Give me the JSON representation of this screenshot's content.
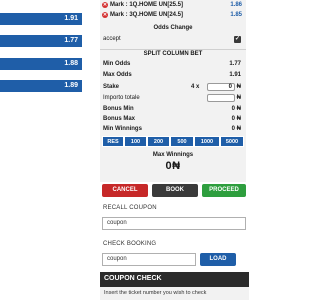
{
  "left_odds": [
    "1.91",
    "1.77",
    "1.88",
    "1.89"
  ],
  "selections": [
    {
      "label": "Mark : 1Q.HOME UN[25.5]",
      "odd": "1.86"
    },
    {
      "label": "Mark : 3Q.HOME UN[24.5]",
      "odd": "1.85"
    }
  ],
  "odds_change": {
    "title": "Odds Change",
    "accept_label": "accept"
  },
  "split": {
    "title": "SPLIT COLUMN BET",
    "min_odds_label": "Min Odds",
    "min_odds": "1.77",
    "max_odds_label": "Max Odds",
    "max_odds": "1.91",
    "stake_label": "Stake",
    "stake_mult": "4 x",
    "stake_value": "0",
    "currency": "₦",
    "importo_label": "Importo totale",
    "importo_currency": "₦",
    "bonus_min_label": "Bonus Min",
    "bonus_min": "0 ₦",
    "bonus_max_label": "Bonus Max",
    "bonus_max": "0 ₦",
    "min_win_label": "Min Winnings",
    "min_win": "0 ₦"
  },
  "quick_stakes": [
    "RES",
    "100",
    "200",
    "500",
    "1000",
    "5000"
  ],
  "max_winnings": {
    "label": "Max Winnings",
    "value": "0₦"
  },
  "actions": {
    "cancel": "CANCEL",
    "book": "BOOK",
    "proceed": "PROCEED"
  },
  "colors": {
    "cancel": "#c62828",
    "book": "#3a3a3a",
    "proceed": "#2e9e3e",
    "blue": "#1f5ea8"
  },
  "recall": {
    "title": "RECALL COUPON",
    "placeholder": "coupon"
  },
  "booking": {
    "title": "CHECK BOOKING",
    "placeholder": "coupon",
    "load": "LOAD"
  },
  "coupon_check": {
    "title": "COUPON CHECK",
    "hint": "Insert the ticket number you wish to check"
  }
}
